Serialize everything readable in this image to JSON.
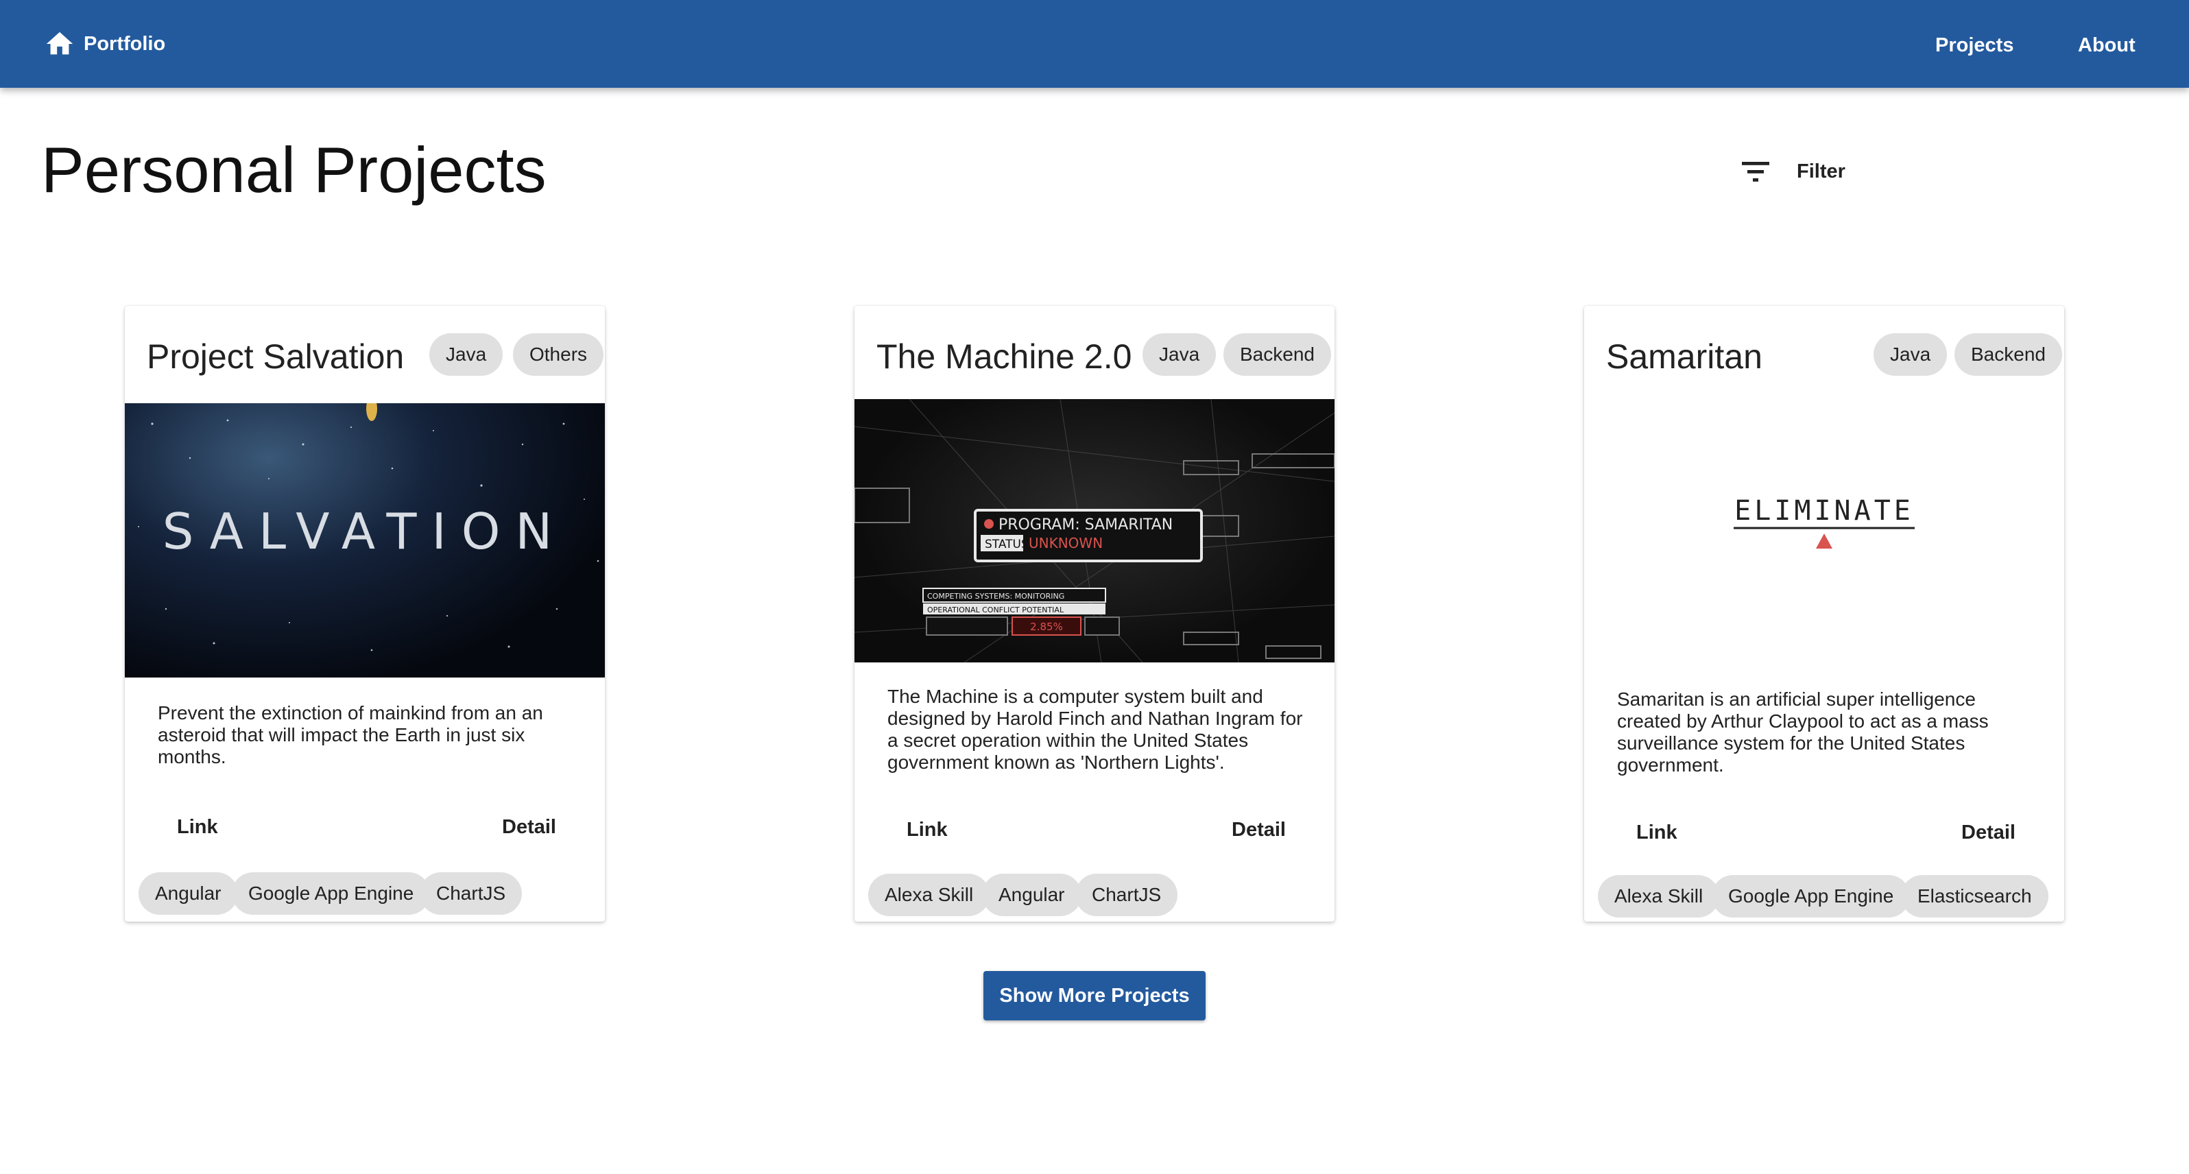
{
  "appbar": {
    "home_label": "Portfolio",
    "nav": [
      {
        "label": "Projects"
      },
      {
        "label": "About"
      }
    ]
  },
  "page": {
    "title": "Personal Projects",
    "filter_label": "Filter",
    "show_more_label": "Show More Projects"
  },
  "projects": [
    {
      "title": "Project Salvation",
      "categories": [
        "Java",
        "Others"
      ],
      "image_text": "SALVATION",
      "description": "Prevent the extinction of mainkind from an an asteroid that will impact the Earth in just six months.",
      "link_label": "Link",
      "detail_label": "Detail",
      "tags": [
        "Angular",
        "Google App Engine",
        "ChartJS"
      ]
    },
    {
      "title": "The Machine 2.0",
      "categories": [
        "Java",
        "Backend"
      ],
      "image_text": {
        "program": "PROGRAM: SAMARITAN",
        "status_label": "STATUS:",
        "status_value": "UNKNOWN",
        "competing": "COMPETING SYSTEMS: MONITORING",
        "threat": "OPERATIONAL CONFLICT POTENTIAL",
        "percent": "2.85%"
      },
      "description": "The Machine is a computer system built and designed by Harold Finch and Nathan Ingram for a secret operation within the United States government known as 'Northern Lights'.",
      "link_label": "Link",
      "detail_label": "Detail",
      "tags": [
        "Alexa Skill",
        "Angular",
        "ChartJS"
      ]
    },
    {
      "title": "Samaritan",
      "categories": [
        "Java",
        "Backend"
      ],
      "image_text": "ELIMINATE",
      "description": "Samaritan is an artificial super intelligence created by Arthur Claypool to act as a mass surveillance system for the United States government.",
      "link_label": "Link",
      "detail_label": "Detail",
      "tags": [
        "Alexa Skill",
        "Google App Engine",
        "Elasticsearch"
      ]
    }
  ],
  "colors": {
    "primary": "#235a9e",
    "chip_bg": "#e0e0e0",
    "alert_red": "#d9534f"
  },
  "icons": {
    "home": "home-icon",
    "filter": "filter-icon"
  }
}
